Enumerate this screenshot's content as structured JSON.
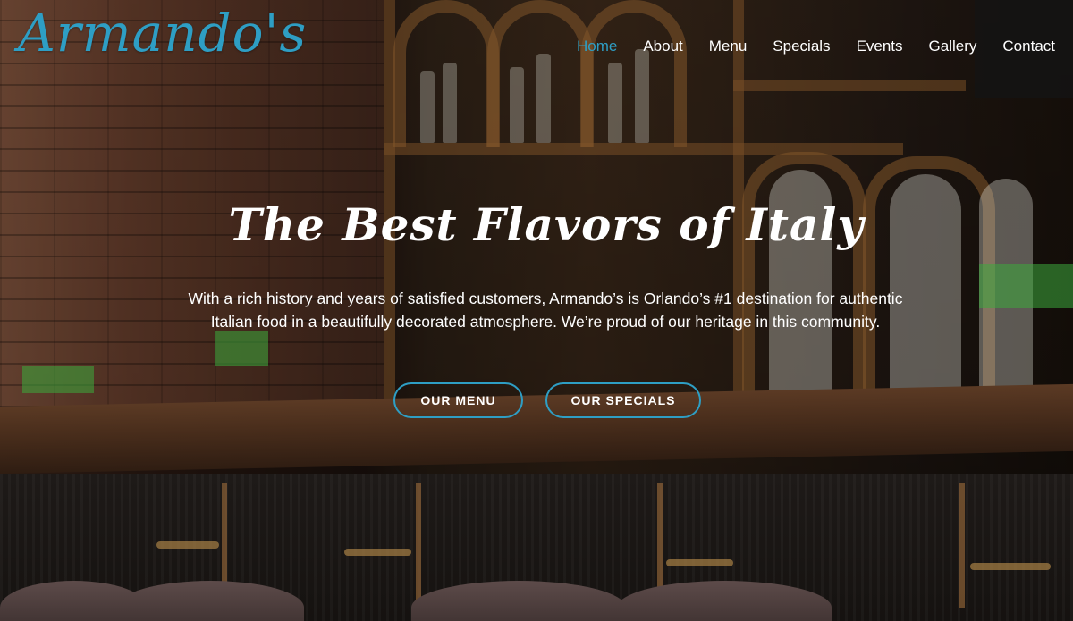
{
  "header": {
    "logo_text": "Armando's",
    "nav": [
      {
        "label": "Home",
        "active": true
      },
      {
        "label": "About",
        "active": false
      },
      {
        "label": "Menu",
        "active": false
      },
      {
        "label": "Specials",
        "active": false
      },
      {
        "label": "Events",
        "active": false
      },
      {
        "label": "Gallery",
        "active": false
      },
      {
        "label": "Contact",
        "active": false
      }
    ]
  },
  "hero": {
    "title": "The Best Flavors of Italy",
    "description": "With a rich history and years of satisfied customers, Armando’s is Orlando’s #1 destination for authentic Italian food in a beautifully decorated atmosphere. We’re proud of our heritage in this community.",
    "buttons": {
      "menu_label": "OUR MENU",
      "specials_label": "OUR SPECIALS"
    }
  },
  "colors": {
    "accent": "#2e9ec4",
    "text": "#ffffff"
  }
}
